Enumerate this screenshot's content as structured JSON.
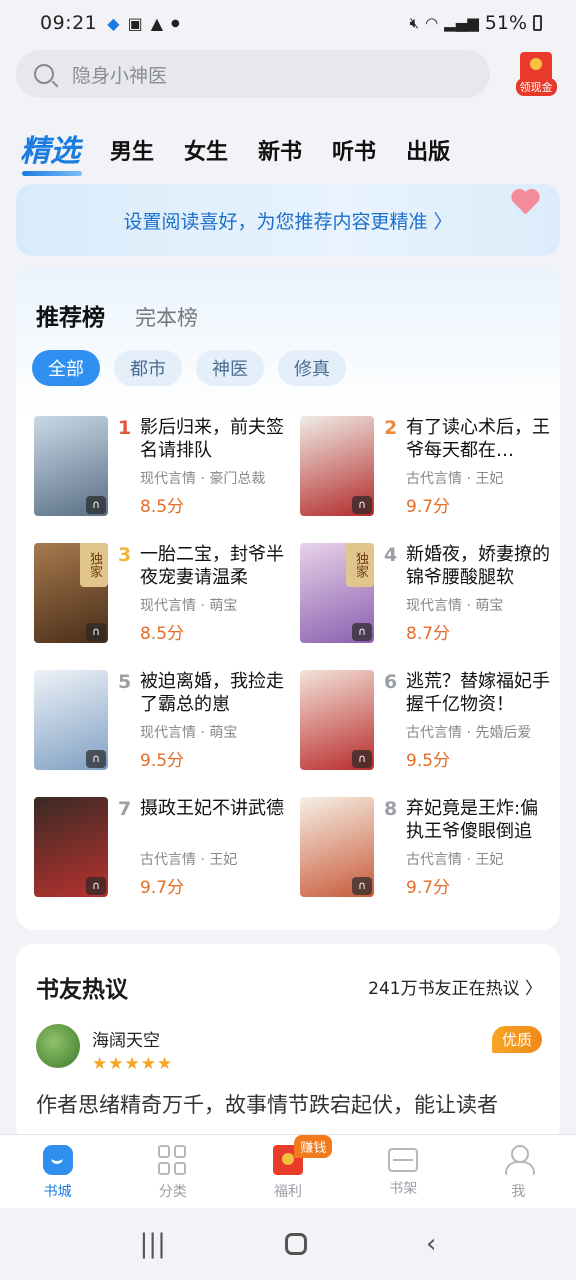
{
  "status_bar": {
    "time": "09:21",
    "battery": "51%"
  },
  "search": {
    "placeholder": "隐身小神医",
    "redpack_label": "领现金"
  },
  "tabs": [
    {
      "label": "精选",
      "active": true
    },
    {
      "label": "男生"
    },
    {
      "label": "女生"
    },
    {
      "label": "新书"
    },
    {
      "label": "听书"
    },
    {
      "label": "出版"
    }
  ],
  "banner": {
    "text": "设置阅读喜好，为您推荐内容更精准 〉"
  },
  "ranking": {
    "tabs": [
      "推荐榜",
      "完本榜"
    ],
    "chips": [
      "全部",
      "都市",
      "神医",
      "修真"
    ],
    "books": [
      {
        "rank": "1",
        "title": "影后归来，前夫签名请排队",
        "meta": "现代言情 · 豪门总裁",
        "score": "8.5分",
        "rank_color": "#e8553a"
      },
      {
        "rank": "2",
        "title": "有了读心术后，王爷每天都在…",
        "meta": "古代言情 · 王妃",
        "score": "9.7分",
        "rank_color": "#f08a3a"
      },
      {
        "rank": "3",
        "title": "一胎二宝，封爷半夜宠妻请温柔",
        "meta": "现代言情 · 萌宝",
        "score": "8.5分",
        "rank_color": "#f2b53a",
        "exclusive": "独家"
      },
      {
        "rank": "4",
        "title": "新婚夜，娇妻撩的锦爷腰酸腿软",
        "meta": "现代言情 · 萌宝",
        "score": "8.7分",
        "rank_color": "#9aa0a6",
        "exclusive": "独家"
      },
      {
        "rank": "5",
        "title": "被迫离婚，我捡走了霸总的崽",
        "meta": "现代言情 · 萌宝",
        "score": "9.5分",
        "rank_color": "#9aa0a6"
      },
      {
        "rank": "6",
        "title": "逃荒？替嫁福妃手握千亿物资！",
        "meta": "古代言情 · 先婚后爱",
        "score": "9.5分",
        "rank_color": "#9aa0a6"
      },
      {
        "rank": "7",
        "title": "摄政王妃不讲武德",
        "meta": "古代言情 · 王妃",
        "score": "9.7分",
        "rank_color": "#9aa0a6"
      },
      {
        "rank": "8",
        "title": "弃妃竟是王炸:偏执王爷傻眼倒追",
        "meta": "古代言情 · 王妃",
        "score": "9.7分",
        "rank_color": "#9aa0a6"
      }
    ]
  },
  "discussion": {
    "title": "书友热议",
    "more": "241万书友正在热议 〉",
    "user": "海阔天空",
    "stars": "★★★★★",
    "badge": "优质",
    "comment": "作者思绪精奇万千，故事情节跌宕起伏，能让读者"
  },
  "bottom_nav": [
    {
      "label": "书城",
      "active": true
    },
    {
      "label": "分类"
    },
    {
      "label": "福利",
      "badge": "赚钱"
    },
    {
      "label": "书架"
    },
    {
      "label": "我"
    }
  ],
  "colors": {
    "accent": "#1a7be0",
    "score": "#e46c26"
  }
}
